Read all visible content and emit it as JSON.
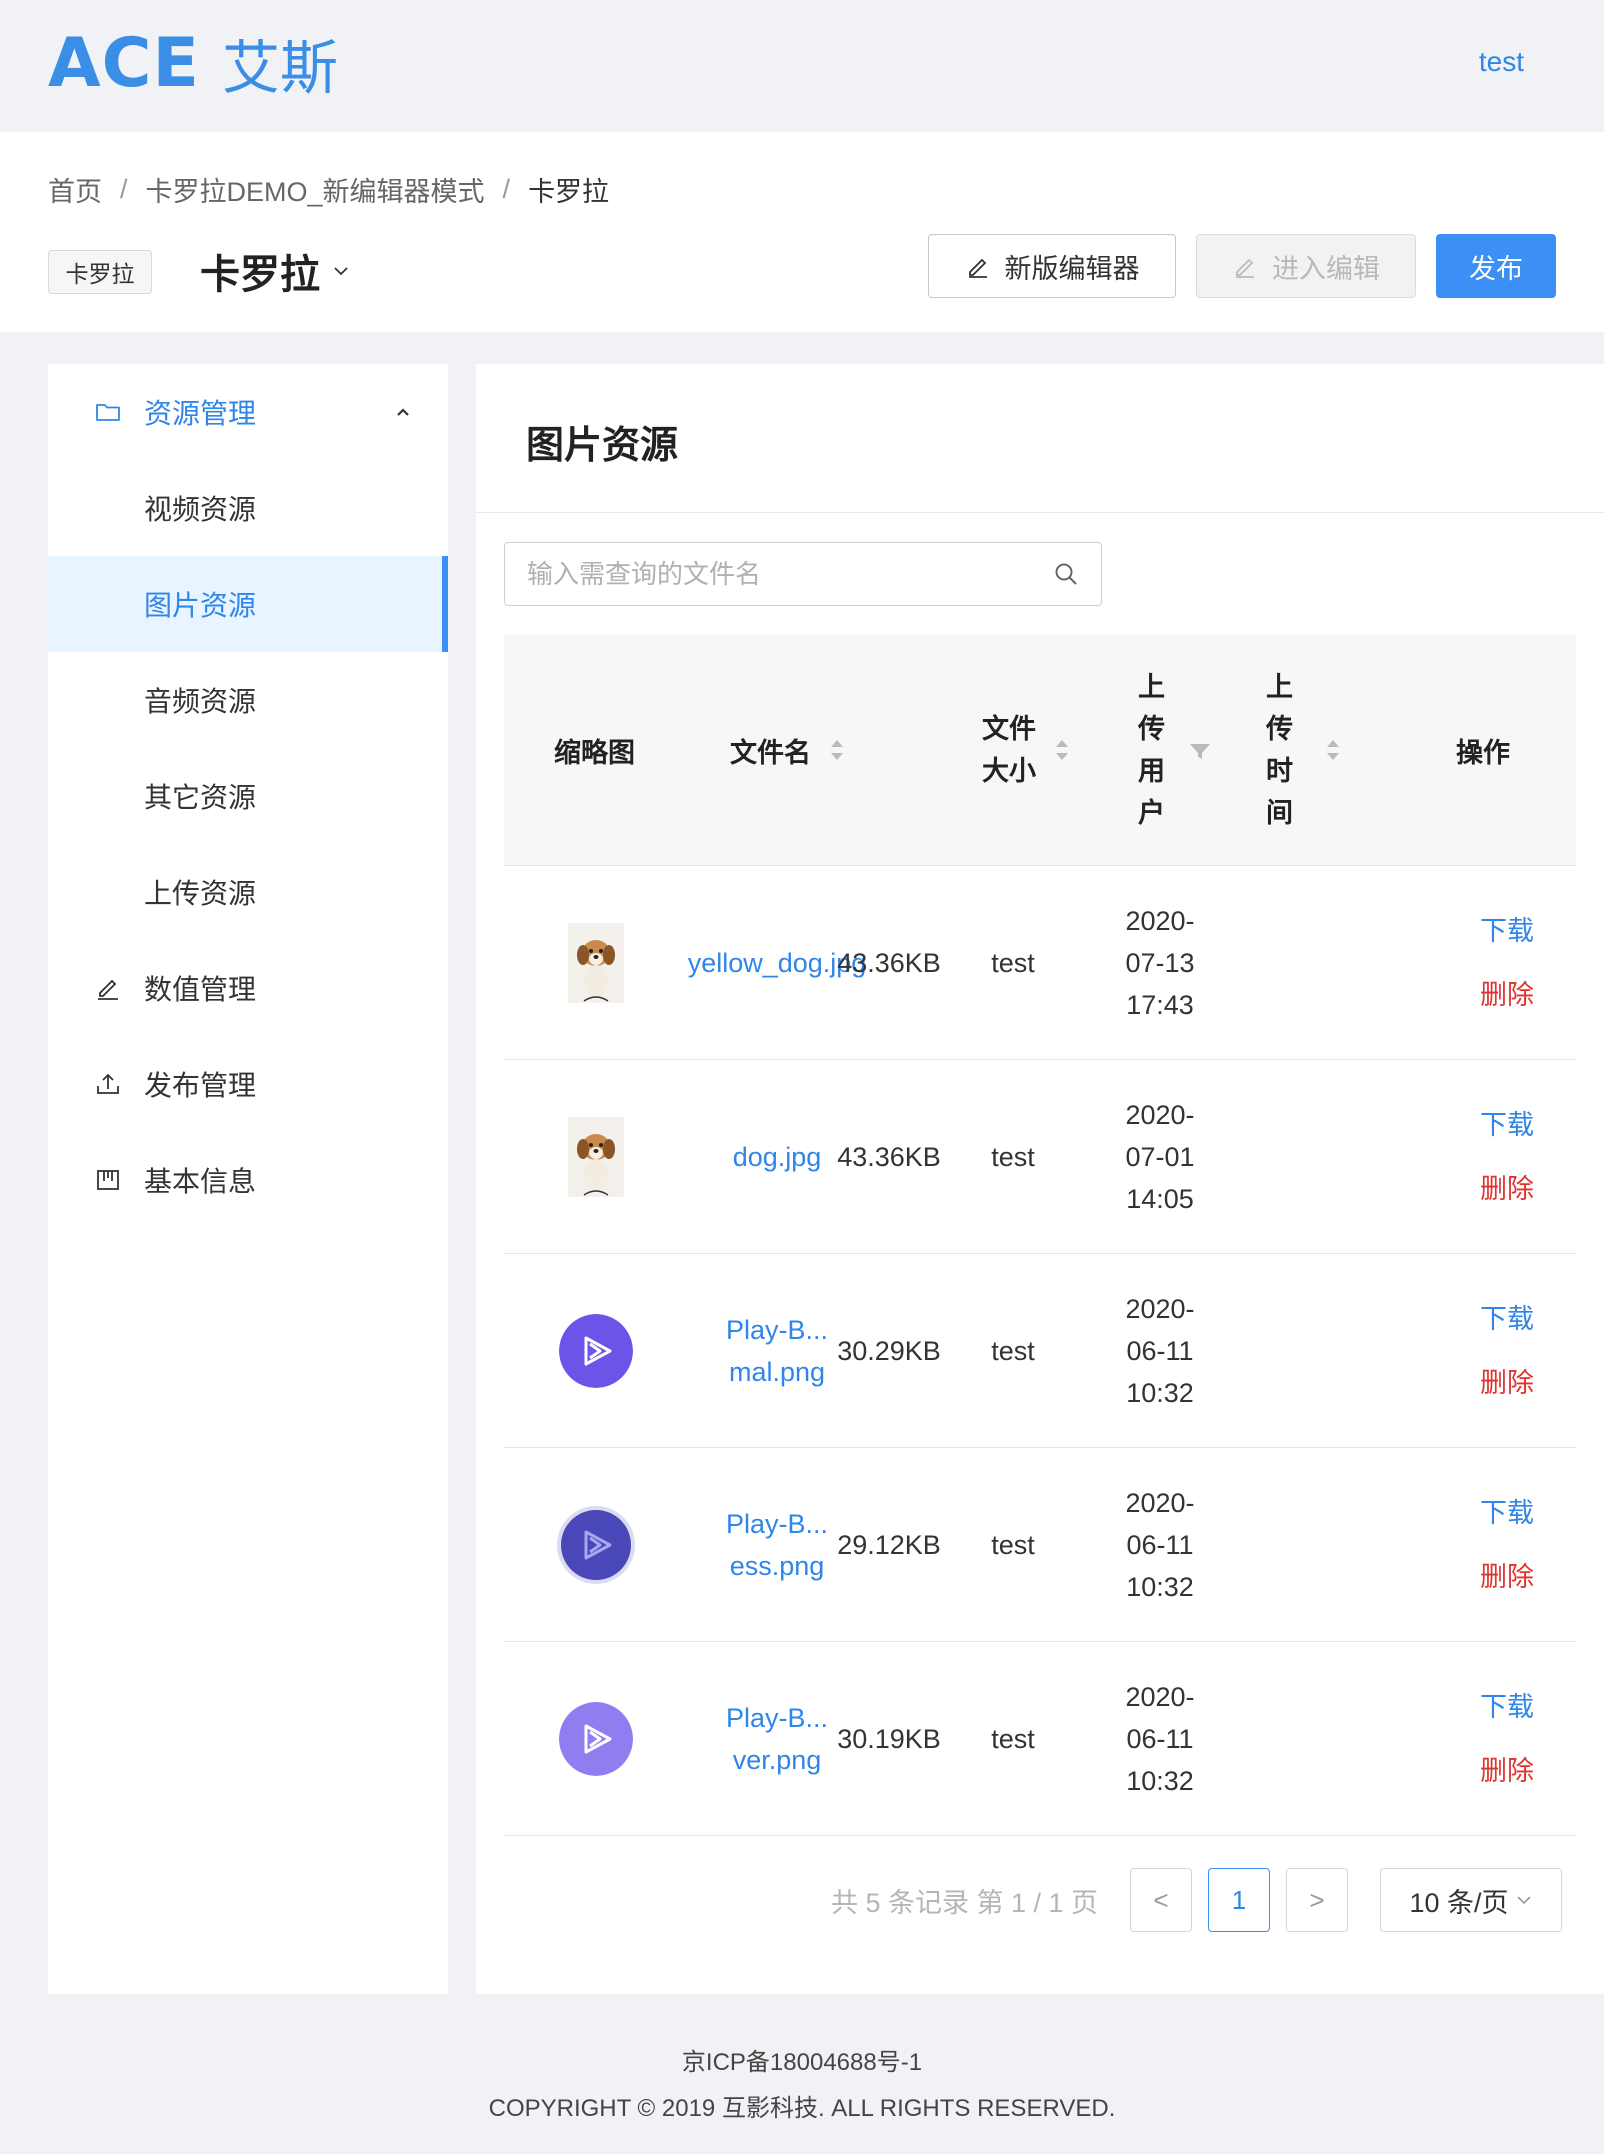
{
  "header": {
    "logo_text": "ACE",
    "logo_cn": "艾斯",
    "user": "test"
  },
  "breadcrumb": [
    "首页",
    "卡罗拉DEMO_新编辑器模式",
    "卡罗拉"
  ],
  "project": {
    "tag": "卡罗拉",
    "title": "卡罗拉"
  },
  "toolbar": {
    "new_editor": "新版编辑器",
    "enter_edit": "进入编辑",
    "publish": "发布"
  },
  "sidebar": {
    "group": "资源管理",
    "sub_items": [
      {
        "label": "视频资源"
      },
      {
        "label": "图片资源"
      },
      {
        "label": "音频资源"
      },
      {
        "label": "其它资源"
      },
      {
        "label": "上传资源"
      }
    ],
    "items": [
      {
        "label": "数值管理"
      },
      {
        "label": "发布管理"
      },
      {
        "label": "基本信息"
      }
    ]
  },
  "main": {
    "title": "图片资源",
    "search_placeholder": "输入需查询的文件名"
  },
  "table": {
    "headers": {
      "thumb": "缩略图",
      "name": "文件名",
      "size_1": "文件",
      "size_2": "大小",
      "user_1": "上",
      "user_2": "传",
      "user_3": "用",
      "user_4": "户",
      "time_1": "上",
      "time_2": "传",
      "time_3": "时",
      "time_4": "间",
      "ops": "操作"
    },
    "rows": [
      {
        "name_1": "yellow_dog.jpg",
        "name_2": "",
        "size": "43.36KB",
        "user": "test",
        "date_1": "2020-",
        "date_2": "07-13",
        "time": "17:43",
        "download": "下载",
        "delete": "删除"
      },
      {
        "name_1": "dog.jpg",
        "name_2": "",
        "size": "43.36KB",
        "user": "test",
        "date_1": "2020-",
        "date_2": "07-01",
        "time": "14:05",
        "download": "下载",
        "delete": "删除"
      },
      {
        "name_1": "Play-B...",
        "name_2": "mal.png",
        "size": "30.29KB",
        "user": "test",
        "date_1": "2020-",
        "date_2": "06-11",
        "time": "10:32",
        "download": "下载",
        "delete": "删除"
      },
      {
        "name_1": "Play-B...",
        "name_2": "ess.png",
        "size": "29.12KB",
        "user": "test",
        "date_1": "2020-",
        "date_2": "06-11",
        "time": "10:32",
        "download": "下载",
        "delete": "删除"
      },
      {
        "name_1": "Play-B...",
        "name_2": "ver.png",
        "size": "30.19KB",
        "user": "test",
        "date_1": "2020-",
        "date_2": "06-11",
        "time": "10:32",
        "download": "下载",
        "delete": "删除"
      }
    ]
  },
  "pagination": {
    "info": "共 5 条记录 第 1 / 1 页",
    "prev": "<",
    "current": "1",
    "next": ">",
    "page_size": "10 条/页"
  },
  "footer": {
    "icp": "京ICP备18004688号-1",
    "copyright": "COPYRIGHT © 2019 互影科技. ALL RIGHTS RESERVED."
  },
  "colors": {
    "accent": "#3b8ff5",
    "link": "#2f86e8",
    "danger": "#e0332e"
  }
}
